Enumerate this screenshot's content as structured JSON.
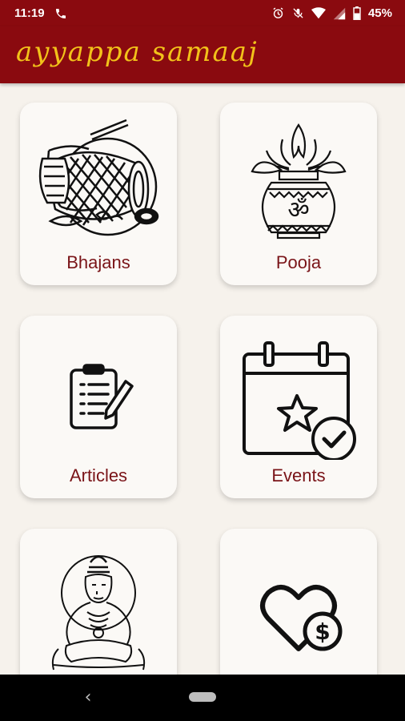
{
  "status_bar": {
    "time": "11:19",
    "battery": "45%",
    "icons": [
      "phone-icon",
      "alarm-icon",
      "mute-icon",
      "wifi-icon",
      "signal-icon",
      "battery-icon"
    ]
  },
  "header": {
    "title": "ayyappa samaaj"
  },
  "tiles": [
    {
      "label": "Bhajans",
      "icon": "drum-instruments-icon"
    },
    {
      "label": "Pooja",
      "icon": "kalash-om-icon"
    },
    {
      "label": "Articles",
      "icon": "clipboard-pen-icon"
    },
    {
      "label": "Events",
      "icon": "calendar-star-check-icon"
    },
    {
      "label": "",
      "icon": "ayyappa-deity-icon"
    },
    {
      "label": "",
      "icon": "heart-dollar-donate-icon"
    }
  ],
  "nav_bar": {
    "back_icon": "back-icon",
    "home_icon": "home-pill-icon"
  },
  "colors": {
    "header_bg": "#8a0a0f",
    "title": "#f2c21a",
    "label": "#7a1418",
    "page_bg": "#f6f2ec"
  }
}
